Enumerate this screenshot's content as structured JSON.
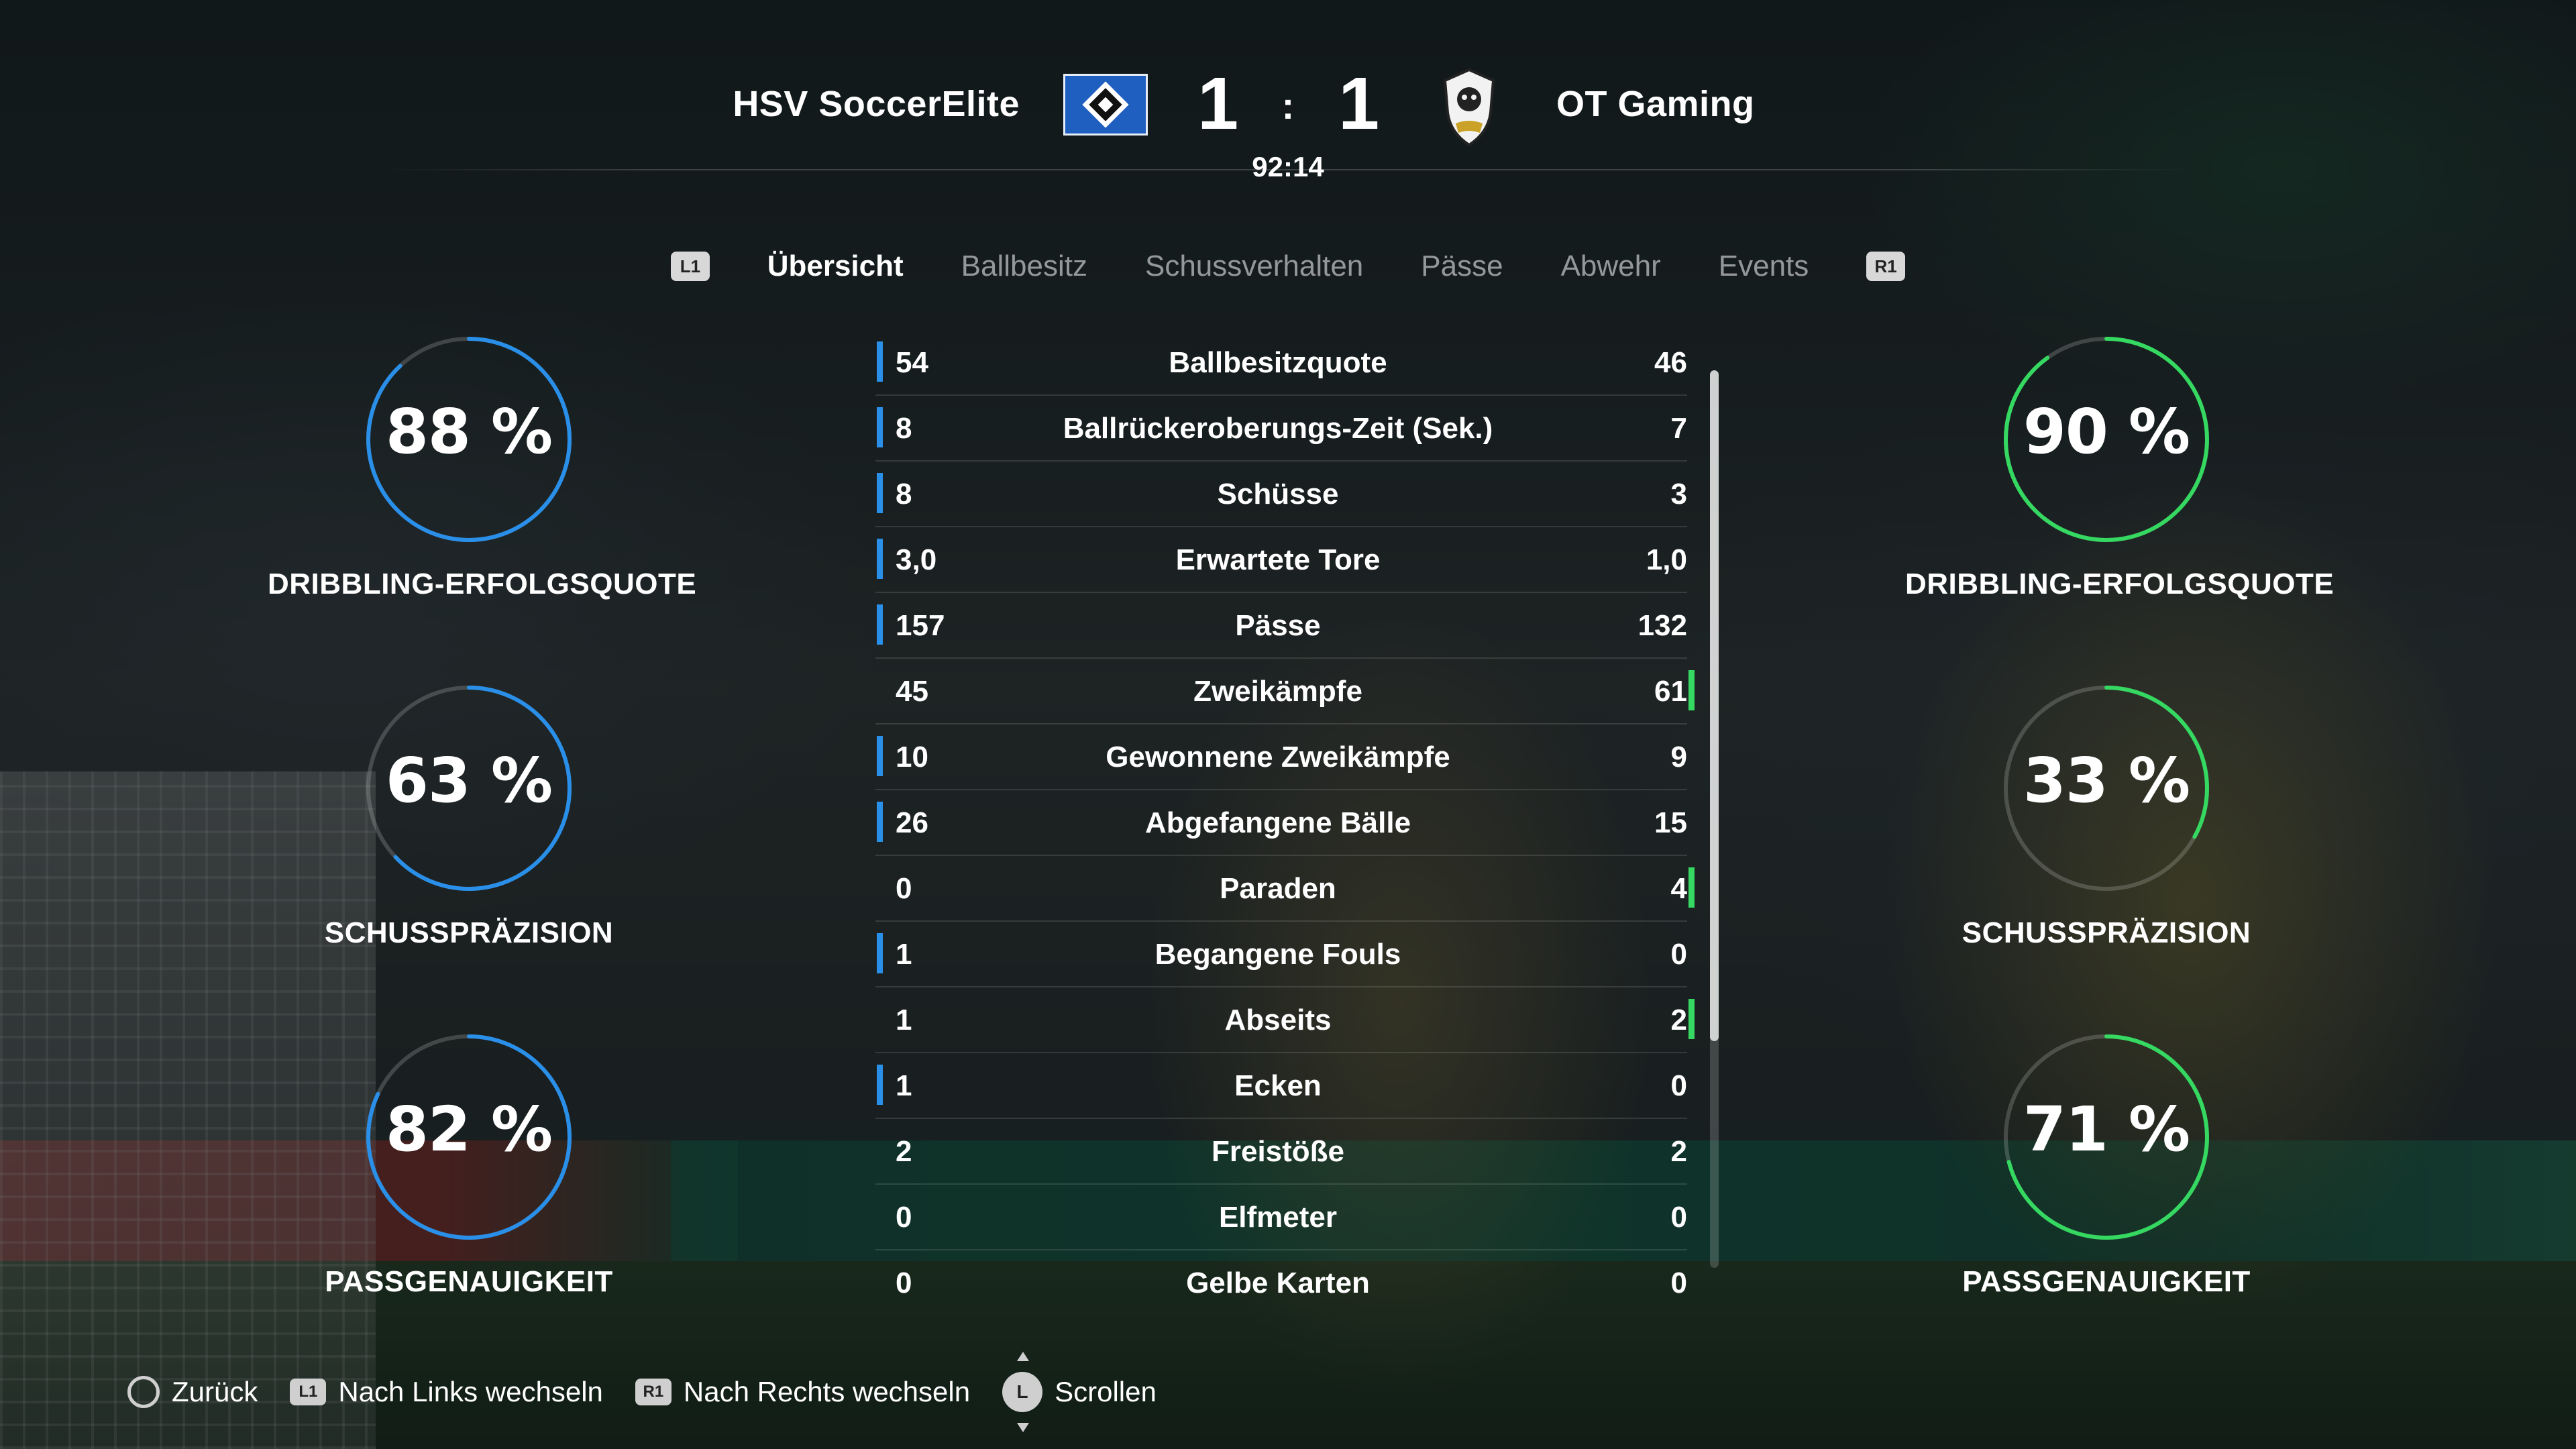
{
  "match": {
    "home_team": "HSV SoccerElite",
    "away_team": "OT Gaming",
    "home_score": "1",
    "away_score": "1",
    "separator": ":",
    "clock": "92:14"
  },
  "tabs": {
    "left_button": "L1",
    "right_button": "R1",
    "items": [
      "Übersicht",
      "Ballbesitz",
      "Schussverhalten",
      "Pässe",
      "Abwehr",
      "Events"
    ],
    "active": "Übersicht"
  },
  "gauges": {
    "home": [
      {
        "value": "88 %",
        "fraction": 0.88,
        "label": "DRIBBLING-ERFOLGSQUOTE"
      },
      {
        "value": "63 %",
        "fraction": 0.63,
        "label": "SCHUSSPRÄZISION"
      },
      {
        "value": "82 %",
        "fraction": 0.82,
        "label": "PASSGENAUIGKEIT"
      }
    ],
    "away": [
      {
        "value": "90 %",
        "fraction": 0.9,
        "label": "DRIBBLING-ERFOLGSQUOTE"
      },
      {
        "value": "33 %",
        "fraction": 0.33,
        "label": "SCHUSSPRÄZISION"
      },
      {
        "value": "71 %",
        "fraction": 0.71,
        "label": "PASSGENAUIGKEIT"
      }
    ],
    "home_color": "#2a8fe8",
    "away_color": "#35d860"
  },
  "stats": [
    {
      "label": "Ballbesitzquote",
      "home": "54",
      "away": "46",
      "leader": "home"
    },
    {
      "label": "Ballrückeroberungs-Zeit (Sek.)",
      "home": "8",
      "away": "7",
      "leader": "home"
    },
    {
      "label": "Schüsse",
      "home": "8",
      "away": "3",
      "leader": "home"
    },
    {
      "label": "Erwartete Tore",
      "home": "3,0",
      "away": "1,0",
      "leader": "home"
    },
    {
      "label": "Pässe",
      "home": "157",
      "away": "132",
      "leader": "home"
    },
    {
      "label": "Zweikämpfe",
      "home": "45",
      "away": "61",
      "leader": "away"
    },
    {
      "label": "Gewonnene Zweikämpfe",
      "home": "10",
      "away": "9",
      "leader": "home"
    },
    {
      "label": "Abgefangene Bälle",
      "home": "26",
      "away": "15",
      "leader": "home"
    },
    {
      "label": "Paraden",
      "home": "0",
      "away": "4",
      "leader": "away"
    },
    {
      "label": "Begangene Fouls",
      "home": "1",
      "away": "0",
      "leader": "home"
    },
    {
      "label": "Abseits",
      "home": "1",
      "away": "2",
      "leader": "away"
    },
    {
      "label": "Ecken",
      "home": "1",
      "away": "0",
      "leader": "home"
    },
    {
      "label": "Freistöße",
      "home": "2",
      "away": "2",
      "leader": "none"
    },
    {
      "label": "Elfmeter",
      "home": "0",
      "away": "0",
      "leader": "none"
    },
    {
      "label": "Gelbe Karten",
      "home": "0",
      "away": "0",
      "leader": "none"
    }
  ],
  "footer": {
    "back": "Zurück",
    "left_chip": "L1",
    "left": "Nach Links wechseln",
    "right_chip": "R1",
    "right": "Nach Rechts wechseln",
    "stick_chip": "L",
    "scroll": "Scrollen"
  }
}
